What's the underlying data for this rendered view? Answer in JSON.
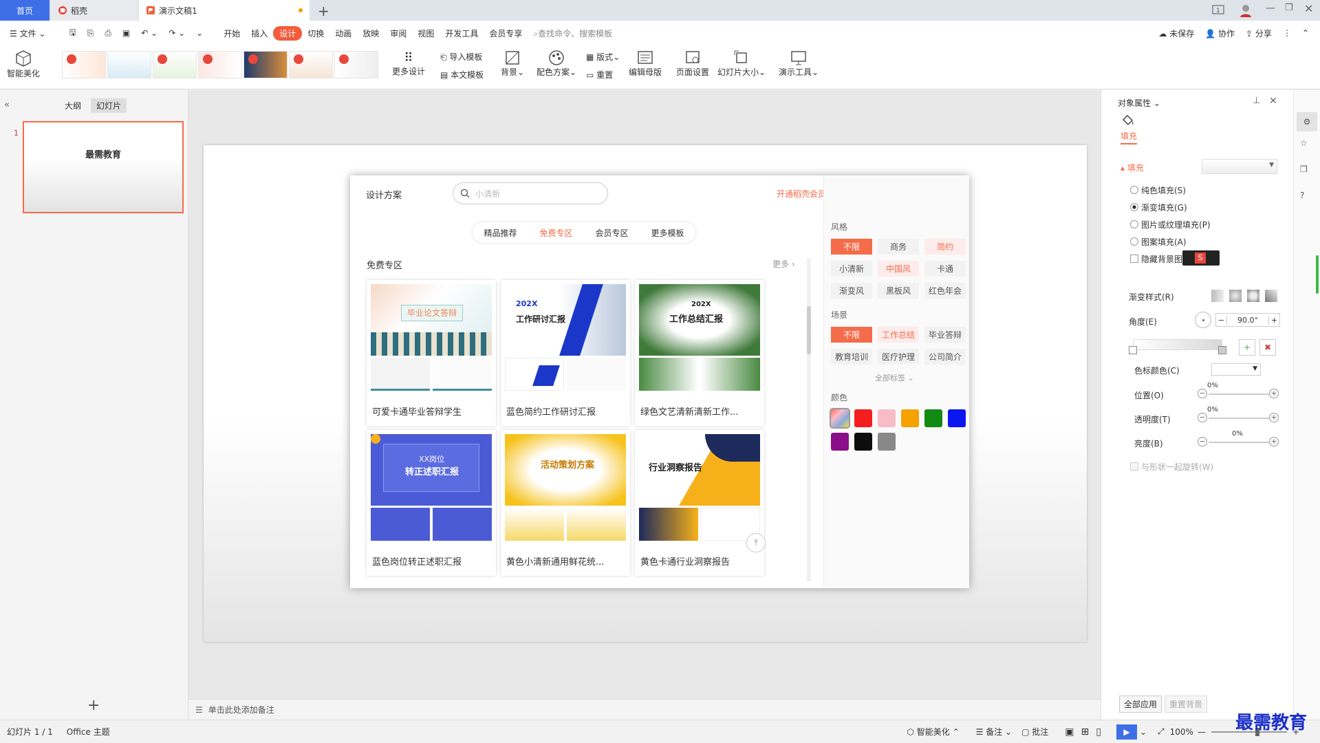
{
  "tabs": {
    "home": "首页",
    "daoke": "稻壳",
    "doc": "演示文稿1"
  },
  "menu": {
    "file": "文件",
    "items": [
      "开始",
      "插入",
      "设计",
      "切换",
      "动画",
      "放映",
      "审阅",
      "视图",
      "开发工具",
      "会员专享"
    ],
    "search": "查找命令、搜索模板",
    "unsaved": "未保存",
    "collab": "协作",
    "share": "分享"
  },
  "ribbon": {
    "smart": "智能美化",
    "more_design": "更多设计",
    "import_tpl": "导入模板",
    "this_tpl": "本文模板",
    "bg": "背景",
    "color_scheme": "配色方案",
    "layout": "版式",
    "reset": "重置",
    "edit_master": "编辑母版",
    "page_setup": "页面设置",
    "slide_size": "幻灯片大小",
    "demo_tools": "演示工具"
  },
  "left": {
    "outline": "大纲",
    "slides": "幻灯片",
    "slide_no": "1",
    "slide_title": "最需教育"
  },
  "notes": "单击此处添加备注",
  "dialog": {
    "title": "设计方案",
    "search_placeholder": "小清新",
    "promo": "开通稻壳会员，全场模板免费用",
    "tabs": [
      "精品推荐",
      "免费专区",
      "会员专区",
      "更多模板"
    ],
    "section": "免费专区",
    "more": "更多",
    "cards": [
      {
        "cap": "可爱卡通毕业答辩学生",
        "txt": "毕业论文答辩"
      },
      {
        "cap": "蓝色简约工作研讨汇报",
        "txt": "202X",
        "txt2": "工作研讨汇报"
      },
      {
        "cap": "绿色文艺清新清新工作...",
        "txt": "202X",
        "txt2": "工作总结汇报"
      },
      {
        "cap": "蓝色岗位转正述职汇报",
        "txt": "XX岗位",
        "txt2": "转正述职汇报"
      },
      {
        "cap": "黄色小清新通用鲜花统...",
        "txt": "活动策划方案"
      },
      {
        "cap": "黄色卡通行业洞察报告",
        "txt": "行业洞察报告"
      }
    ],
    "style_label": "风格",
    "styles": [
      "不限",
      "商务",
      "简约",
      "小清新",
      "中国风",
      "卡通",
      "渐变风",
      "黑板风",
      "红色年会"
    ],
    "scene_label": "场景",
    "scenes": [
      "不限",
      "工作总结",
      "毕业答辩",
      "教育培训",
      "医疗护理",
      "公司简介"
    ],
    "all_tags": "全部标签",
    "color_label": "颜色",
    "colors": [
      "#ff6b5a",
      "#f41e1e",
      "#f8bcc8",
      "#f5a100",
      "#138a13",
      "#0c16f0",
      "#8a0d8a",
      "#0d0d0d",
      "#888888"
    ]
  },
  "panel": {
    "title": "对象属性",
    "fill_tab": "填充",
    "fill_section": "填充",
    "options": [
      "纯色填充(S)",
      "渐变填充(G)",
      "图片或纹理填充(P)",
      "图案填充(A)"
    ],
    "hide_bg": "隐藏背景图形",
    "grad_style": "渐变样式(R)",
    "angle": "角度(E)",
    "angle_val": "90.0°",
    "stop_color": "色标颜色(C)",
    "position": "位置(O)",
    "transparency": "透明度(T)",
    "brightness": "亮度(B)",
    "pct": "0%",
    "rotate": "与形状一起旋转(W)",
    "apply_all": "全部应用",
    "reset_bg": "重置背景"
  },
  "status": {
    "slide": "幻灯片 1 / 1",
    "theme": "Office 主题",
    "smart": "智能美化",
    "notes": "备注",
    "comment": "批注",
    "zoom": "100%"
  },
  "watermark": "最需教育"
}
